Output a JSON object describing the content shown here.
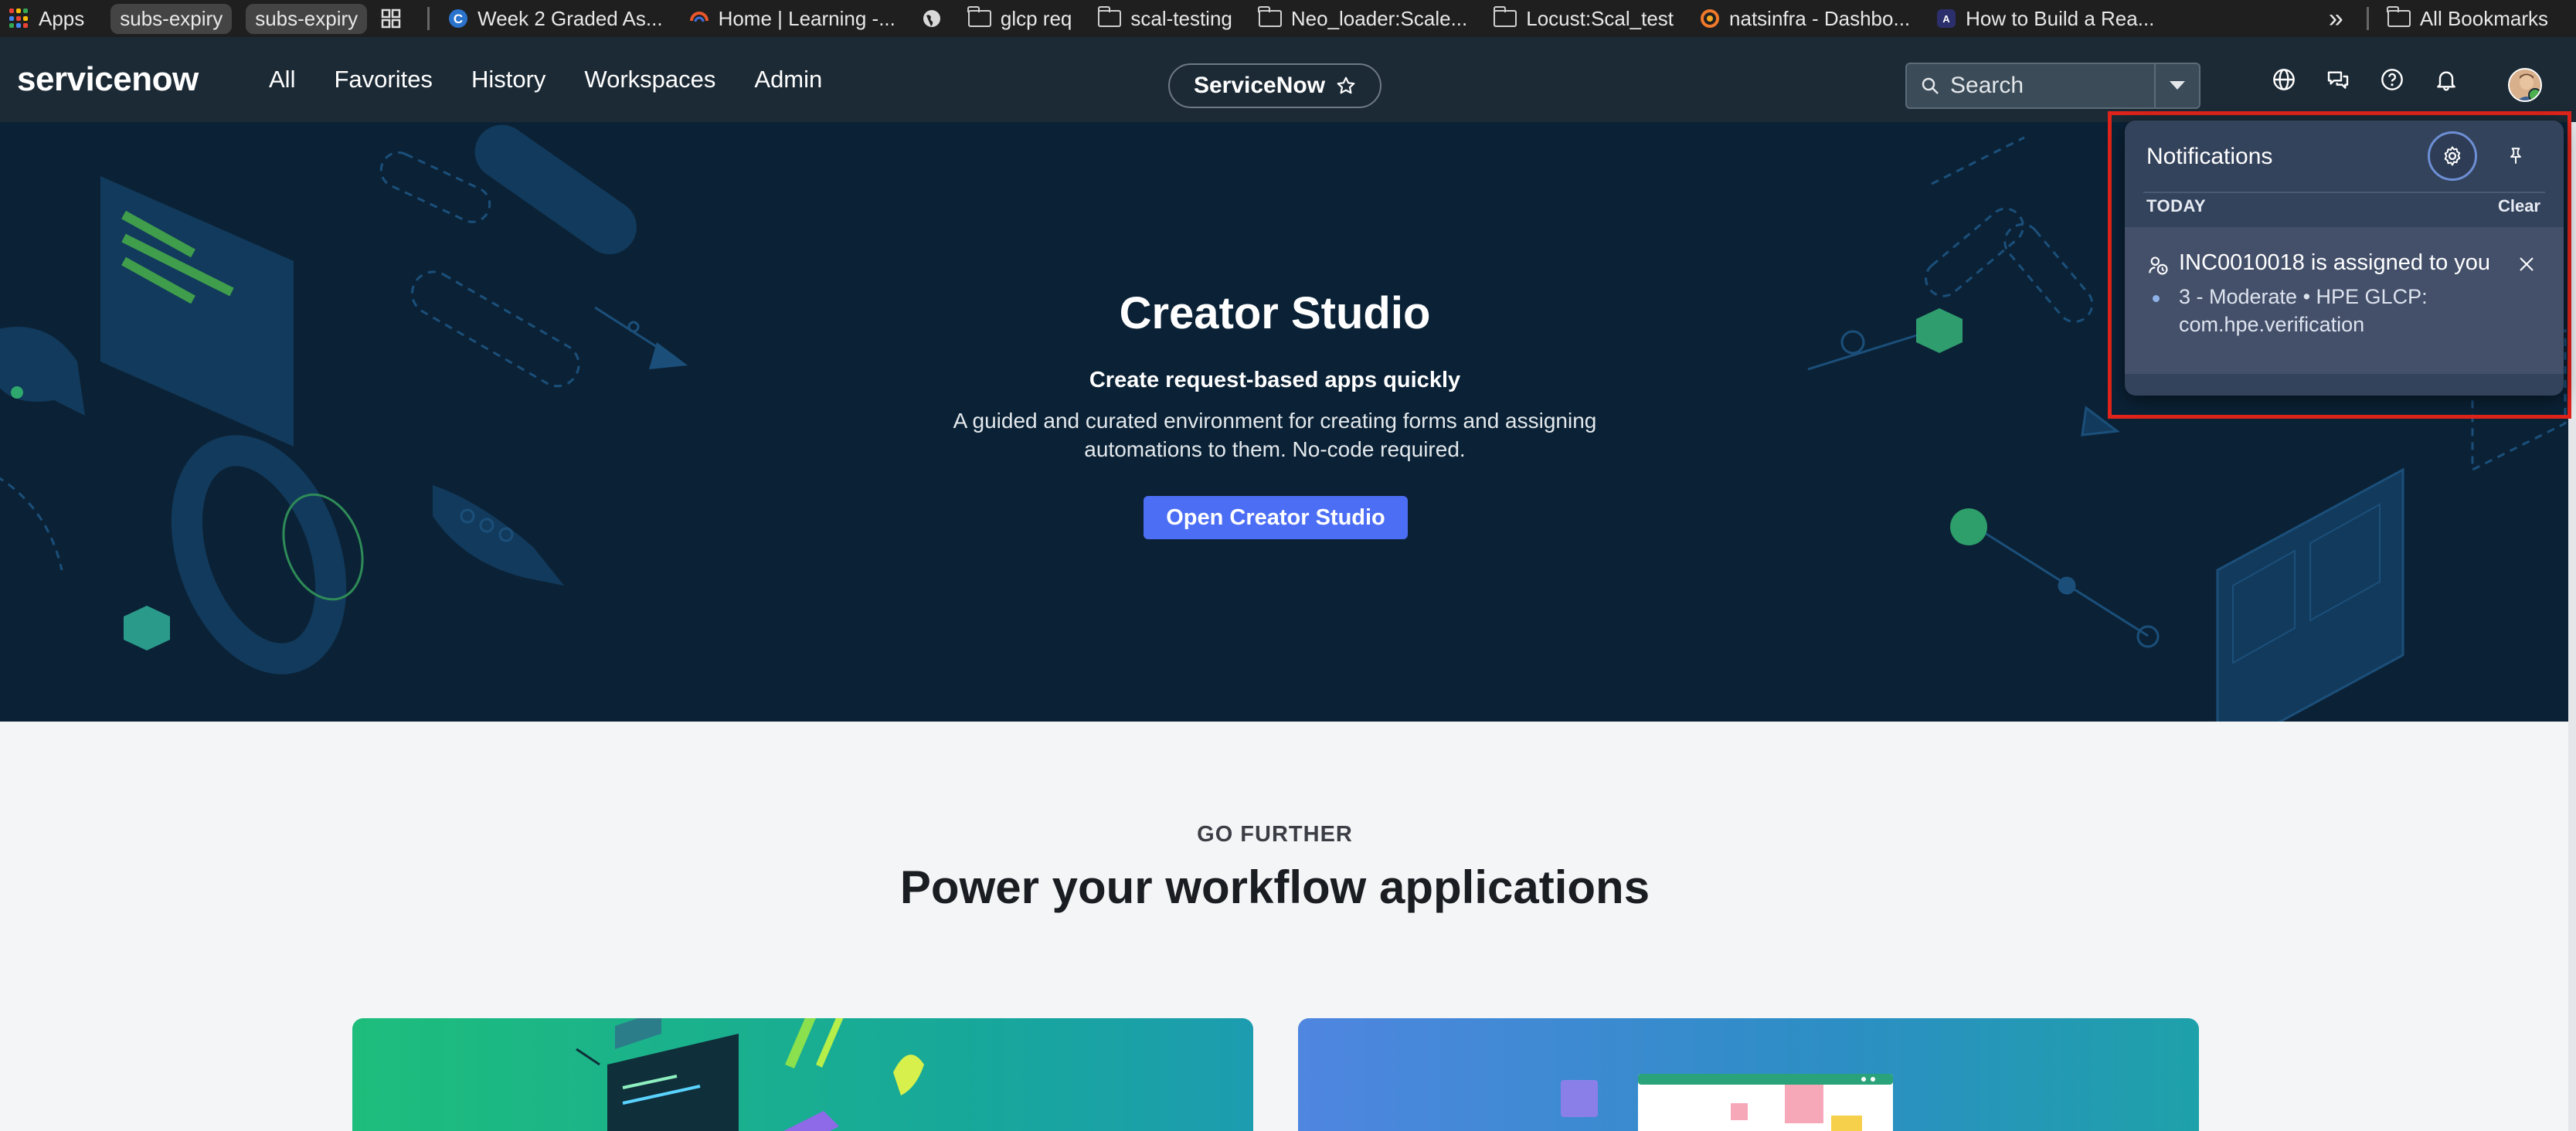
{
  "bookmarks": {
    "apps_label": "Apps",
    "pills": [
      "subs-expiry",
      "subs-expiry"
    ],
    "items": [
      {
        "label": "Week 2 Graded As...",
        "icon": "coursera-icon"
      },
      {
        "label": "Home | Learning -...",
        "icon": "learning-icon"
      },
      {
        "label": "",
        "icon": "globe-icon"
      },
      {
        "label": "glcp req",
        "icon": "folder-icon"
      },
      {
        "label": "scal-testing",
        "icon": "folder-icon"
      },
      {
        "label": "Neo_loader:Scale...",
        "icon": "folder-icon"
      },
      {
        "label": "Locust:Scal_test",
        "icon": "folder-icon"
      },
      {
        "label": "natsinfra - Dashbo...",
        "icon": "grafana-icon"
      },
      {
        "label": "How to Build a Rea...",
        "icon": "ai-icon"
      }
    ],
    "overflow": "»",
    "all_bookmarks": "All Bookmarks"
  },
  "header": {
    "logo": "servicenow",
    "nav": [
      "All",
      "Favorites",
      "History",
      "Workspaces",
      "Admin"
    ],
    "context_pill": "ServiceNow",
    "search_placeholder": "Search"
  },
  "hero": {
    "title": "Creator Studio",
    "subtitle": "Create request-based apps quickly",
    "description": "A guided and curated environment for creating forms and assigning automations to them. No-code required.",
    "button": "Open Creator Studio"
  },
  "lower": {
    "eyebrow": "GO FURTHER",
    "title": "Power your workflow applications"
  },
  "notifications": {
    "title": "Notifications",
    "section": "TODAY",
    "clear": "Clear",
    "item_title": "INC0010018 is assigned to you",
    "item_detail": "3 - Moderate • HPE GLCP: com.hpe.verification"
  },
  "colors": {
    "header_bg": "#1c2a35",
    "hero_bg": "#0b2236",
    "accent_button": "#4c6ef5",
    "panel_bg": "#34435c",
    "highlight_box": "#e0241b"
  }
}
